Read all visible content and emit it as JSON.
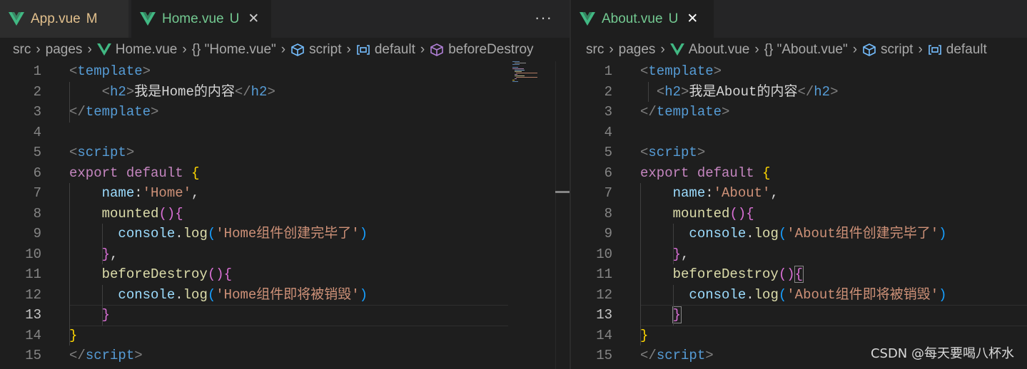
{
  "left": {
    "tabs": [
      {
        "name": "App.vue",
        "status": "M"
      },
      {
        "name": "Home.vue",
        "status": "U"
      }
    ],
    "more_label": "···",
    "breadcrumb": [
      "src",
      "pages",
      "Home.vue",
      "{} \"Home.vue\"",
      "script",
      "default",
      "beforeDestroy"
    ],
    "lines": [
      {
        "n": "1",
        "tokens": [
          [
            "<",
            "t-punct"
          ],
          [
            "template",
            "t-tag"
          ],
          [
            ">",
            "t-punct"
          ]
        ]
      },
      {
        "n": "2",
        "tokens": [
          [
            "    ",
            "t-plain"
          ],
          [
            "<",
            "t-punct"
          ],
          [
            "h2",
            "t-tag"
          ],
          [
            ">",
            "t-punct"
          ],
          [
            "我是Home的内容",
            "t-text"
          ],
          [
            "</",
            "t-punct"
          ],
          [
            "h2",
            "t-tag"
          ],
          [
            ">",
            "t-punct"
          ]
        ]
      },
      {
        "n": "3",
        "tokens": [
          [
            "</",
            "t-punct"
          ],
          [
            "template",
            "t-tag"
          ],
          [
            ">",
            "t-punct"
          ]
        ]
      },
      {
        "n": "4",
        "tokens": []
      },
      {
        "n": "5",
        "tokens": [
          [
            "<",
            "t-punct"
          ],
          [
            "script",
            "t-tag"
          ],
          [
            ">",
            "t-punct"
          ]
        ]
      },
      {
        "n": "6",
        "tokens": [
          [
            "export",
            "t-kw"
          ],
          [
            " ",
            "t-plain"
          ],
          [
            "default",
            "t-kw"
          ],
          [
            " ",
            "t-plain"
          ],
          [
            "{",
            "t-brace"
          ]
        ]
      },
      {
        "n": "7",
        "tokens": [
          [
            "    ",
            "t-plain"
          ],
          [
            "name",
            "t-prop"
          ],
          [
            ":",
            "t-plain"
          ],
          [
            "'Home'",
            "t-str"
          ],
          [
            ",",
            "t-plain"
          ]
        ]
      },
      {
        "n": "8",
        "tokens": [
          [
            "    ",
            "t-plain"
          ],
          [
            "mounted",
            "t-fn"
          ],
          [
            "()",
            "t-paren"
          ],
          [
            "{",
            "t-brace2"
          ]
        ]
      },
      {
        "n": "9",
        "tokens": [
          [
            "      ",
            "t-plain"
          ],
          [
            "console",
            "t-prop"
          ],
          [
            ".",
            "t-plain"
          ],
          [
            "log",
            "t-fn"
          ],
          [
            "(",
            "t-brace3"
          ],
          [
            "'Home组件创建完毕了'",
            "t-str"
          ],
          [
            ")",
            "t-brace3"
          ]
        ]
      },
      {
        "n": "10",
        "tokens": [
          [
            "    ",
            "t-plain"
          ],
          [
            "}",
            "t-brace2"
          ],
          [
            ",",
            "t-plain"
          ]
        ]
      },
      {
        "n": "11",
        "tokens": [
          [
            "    ",
            "t-plain"
          ],
          [
            "beforeDestroy",
            "t-fn"
          ],
          [
            "()",
            "t-paren"
          ],
          [
            "{",
            "t-brace2"
          ]
        ]
      },
      {
        "n": "12",
        "tokens": [
          [
            "      ",
            "t-plain"
          ],
          [
            "console",
            "t-prop"
          ],
          [
            ".",
            "t-plain"
          ],
          [
            "log",
            "t-fn"
          ],
          [
            "(",
            "t-brace3"
          ],
          [
            "'Home组件即将被销毁'",
            "t-str"
          ],
          [
            ")",
            "t-brace3"
          ]
        ]
      },
      {
        "n": "13",
        "tokens": [
          [
            "    ",
            "t-plain"
          ],
          [
            "}",
            "t-brace2"
          ]
        ]
      },
      {
        "n": "14",
        "tokens": [
          [
            "}",
            "t-brace"
          ]
        ]
      },
      {
        "n": "15",
        "tokens": [
          [
            "</",
            "t-punct"
          ],
          [
            "script",
            "t-tag"
          ],
          [
            ">",
            "t-punct"
          ]
        ]
      }
    ]
  },
  "right": {
    "tabs": [
      {
        "name": "About.vue",
        "status": "U"
      }
    ],
    "breadcrumb": [
      "src",
      "pages",
      "About.vue",
      "{} \"About.vue\"",
      "script",
      "default"
    ],
    "lines": [
      {
        "n": "1",
        "tokens": [
          [
            "<",
            "t-punct"
          ],
          [
            "template",
            "t-tag"
          ],
          [
            ">",
            "t-punct"
          ]
        ]
      },
      {
        "n": "2",
        "tokens": [
          [
            "  ",
            "t-plain"
          ],
          [
            "<",
            "t-punct"
          ],
          [
            "h2",
            "t-tag"
          ],
          [
            ">",
            "t-punct"
          ],
          [
            "我是About的内容",
            "t-text"
          ],
          [
            "</",
            "t-punct"
          ],
          [
            "h2",
            "t-tag"
          ],
          [
            ">",
            "t-punct"
          ]
        ]
      },
      {
        "n": "3",
        "tokens": [
          [
            "</",
            "t-punct"
          ],
          [
            "template",
            "t-tag"
          ],
          [
            ">",
            "t-punct"
          ]
        ]
      },
      {
        "n": "4",
        "tokens": []
      },
      {
        "n": "5",
        "tokens": [
          [
            "<",
            "t-punct"
          ],
          [
            "script",
            "t-tag"
          ],
          [
            ">",
            "t-punct"
          ]
        ]
      },
      {
        "n": "6",
        "tokens": [
          [
            "export",
            "t-kw"
          ],
          [
            " ",
            "t-plain"
          ],
          [
            "default",
            "t-kw"
          ],
          [
            " ",
            "t-plain"
          ],
          [
            "{",
            "t-brace"
          ]
        ]
      },
      {
        "n": "7",
        "tokens": [
          [
            "    ",
            "t-plain"
          ],
          [
            "name",
            "t-prop"
          ],
          [
            ":",
            "t-plain"
          ],
          [
            "'About'",
            "t-str"
          ],
          [
            ",",
            "t-plain"
          ]
        ]
      },
      {
        "n": "8",
        "tokens": [
          [
            "    ",
            "t-plain"
          ],
          [
            "mounted",
            "t-fn"
          ],
          [
            "()",
            "t-paren"
          ],
          [
            "{",
            "t-brace2"
          ]
        ]
      },
      {
        "n": "9",
        "tokens": [
          [
            "      ",
            "t-plain"
          ],
          [
            "console",
            "t-prop"
          ],
          [
            ".",
            "t-plain"
          ],
          [
            "log",
            "t-fn"
          ],
          [
            "(",
            "t-brace3"
          ],
          [
            "'About组件创建完毕了'",
            "t-str"
          ],
          [
            ")",
            "t-brace3"
          ]
        ]
      },
      {
        "n": "10",
        "tokens": [
          [
            "    ",
            "t-plain"
          ],
          [
            "}",
            "t-brace2"
          ],
          [
            ",",
            "t-plain"
          ]
        ]
      },
      {
        "n": "11",
        "tokens": [
          [
            "    ",
            "t-plain"
          ],
          [
            "beforeDestroy",
            "t-fn"
          ],
          [
            "()",
            "t-paren"
          ],
          [
            "{",
            "t-brace2 t-match"
          ]
        ]
      },
      {
        "n": "12",
        "tokens": [
          [
            "      ",
            "t-plain"
          ],
          [
            "console",
            "t-prop"
          ],
          [
            ".",
            "t-plain"
          ],
          [
            "log",
            "t-fn"
          ],
          [
            "(",
            "t-brace3"
          ],
          [
            "'About组件即将被销毁'",
            "t-str"
          ],
          [
            ")",
            "t-brace3"
          ]
        ]
      },
      {
        "n": "13",
        "tokens": [
          [
            "    ",
            "t-plain"
          ],
          [
            "}",
            "t-brace2 t-match"
          ]
        ]
      },
      {
        "n": "14",
        "tokens": [
          [
            "}",
            "t-brace"
          ]
        ]
      },
      {
        "n": "15",
        "tokens": [
          [
            "</",
            "t-punct"
          ],
          [
            "script",
            "t-tag"
          ],
          [
            ">",
            "t-punct"
          ]
        ]
      }
    ]
  },
  "active_line": "13",
  "watermark": "CSDN @每天要喝八杯水"
}
